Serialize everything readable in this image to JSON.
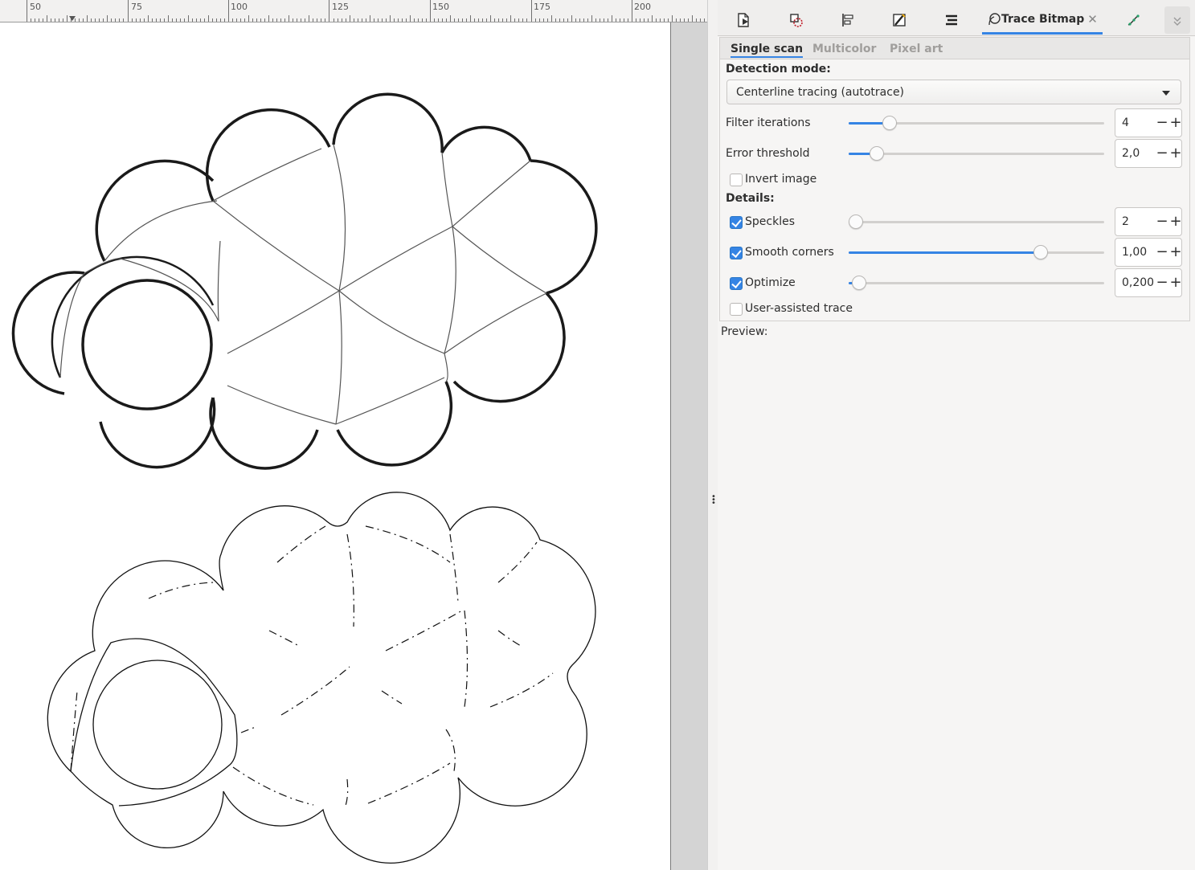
{
  "ruler": {
    "labels": [
      "50",
      "75",
      "100",
      "125",
      "150",
      "175",
      "200"
    ]
  },
  "dock": {
    "tabs": [
      {
        "icon": "document-properties-icon"
      },
      {
        "icon": "fill-stroke-icon"
      },
      {
        "icon": "align-distribute-icon"
      },
      {
        "icon": "xml-editor-icon"
      },
      {
        "icon": "layers-icon"
      },
      {
        "icon": "trace-bitmap-icon",
        "label": "Trace Bitmap",
        "active": true,
        "close_icon": "close-icon"
      },
      {
        "icon": "path-effects-icon"
      },
      {
        "icon": "overflow-arrow-icon"
      }
    ]
  },
  "trace_bitmap": {
    "subtabs": [
      "Single scan",
      "Multicolor",
      "Pixel art"
    ],
    "active_subtab": "Single scan",
    "detection_mode_label": "Detection mode:",
    "detection_mode_value": "Centerline tracing (autotrace)",
    "filter_iterations": {
      "label": "Filter iterations",
      "value": "4",
      "level": 0.16
    },
    "error_threshold": {
      "label": "Error threshold",
      "value": "2,0",
      "level": 0.11
    },
    "invert_image": {
      "label": "Invert image",
      "checked": false
    },
    "details_label": "Details:",
    "speckles": {
      "label": "Speckles",
      "value": "2",
      "checked": true,
      "level": 0.0
    },
    "smooth_corners": {
      "label": "Smooth corners",
      "value": "1,00",
      "checked": true,
      "level": 0.75
    },
    "optimize": {
      "label": "Optimize",
      "value": "0,200",
      "checked": true,
      "level": 0.04
    },
    "user_assisted": {
      "label": "User-assisted trace",
      "checked": false
    },
    "preview_label": "Preview:"
  },
  "colors": {
    "accent": "#3584e4",
    "panel_bg": "#f6f5f4",
    "canvas_bg": "#d4d4d4",
    "page_bg": "#ffffff"
  }
}
